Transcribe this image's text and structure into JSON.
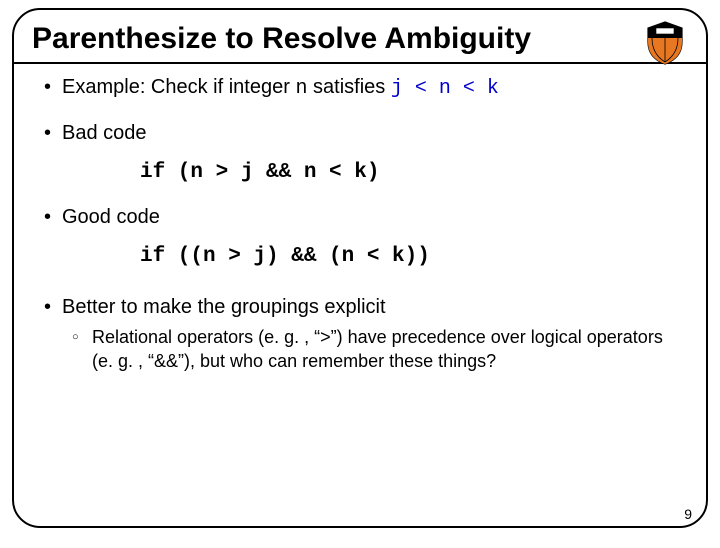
{
  "title": "Parenthesize to Resolve Ambiguity",
  "bullets": {
    "example_prefix": "Example: Check if integer ",
    "example_var": "n",
    "example_mid": " satisfies ",
    "example_expr": "j < n < k",
    "bad_label": "Bad code",
    "bad_code": "if (n > j && n < k)",
    "good_label": "Good code",
    "good_code": "if ((n > j) && (n < k))",
    "better_label": "Better to make the groupings explicit",
    "sub_prefix": "Relational operators (e. g. , ",
    "sub_q1": "“>”",
    "sub_mid": ") have precedence over logical operators (e. g. , ",
    "sub_q2": "“&&”",
    "sub_suffix": "), but who can remember these things?"
  },
  "page_number": "9",
  "chart_data": {
    "type": "table",
    "note": "slide content; no quantitative chart"
  }
}
